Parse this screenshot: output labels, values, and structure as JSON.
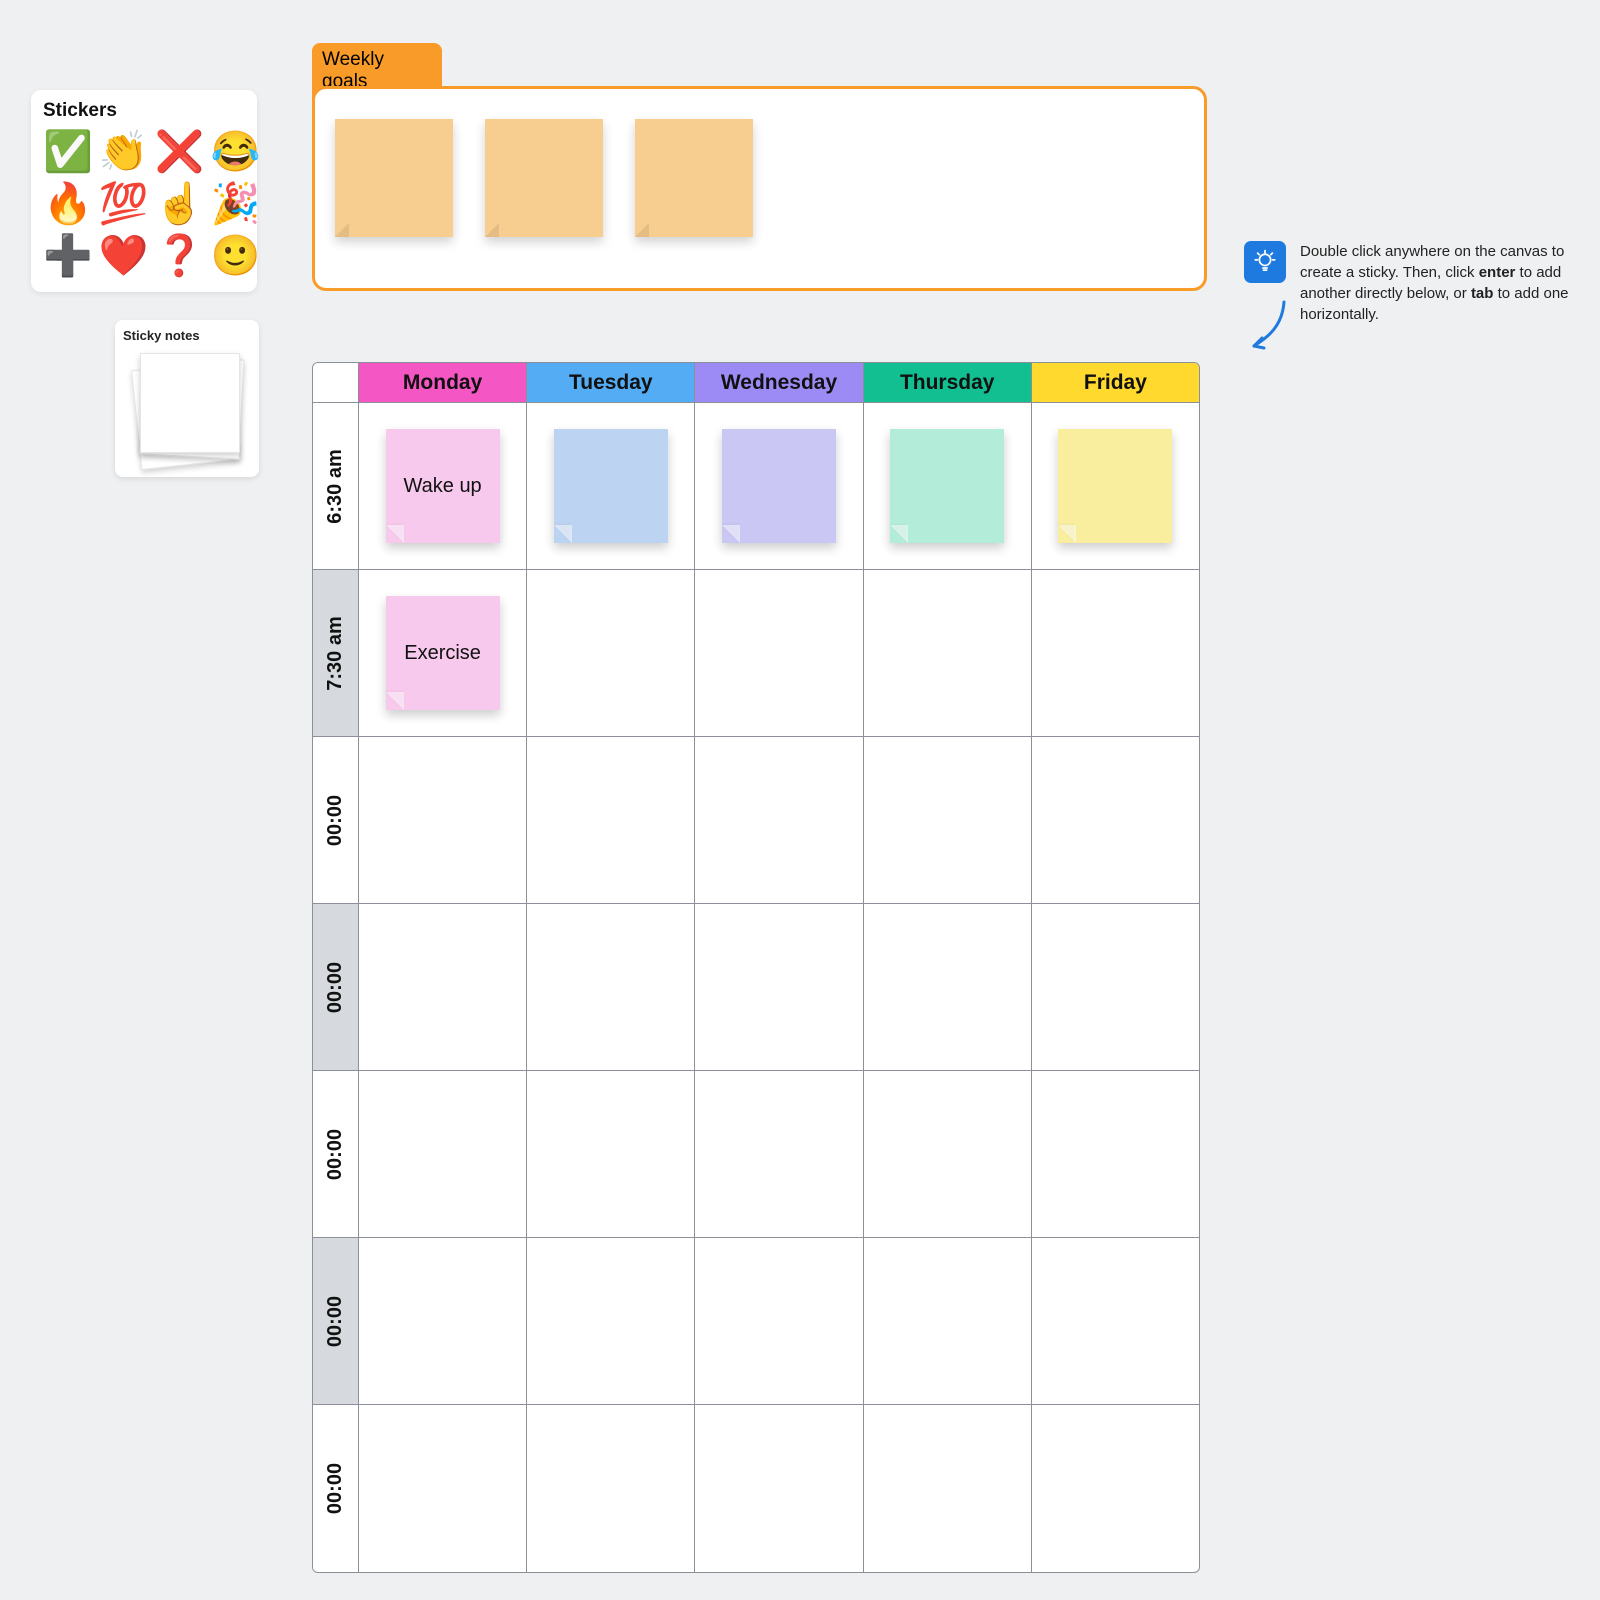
{
  "stickers": {
    "title": "Stickers",
    "items": [
      "✅",
      "👏",
      "❌",
      "😂",
      "🔥",
      "💯",
      "☝️",
      "🎉",
      "➕",
      "❤️",
      "❓",
      "🙂"
    ]
  },
  "sticky_panel": {
    "title": "Sticky notes"
  },
  "goals": {
    "tab_line1": "Weekly",
    "tab_line2": "goals",
    "notes": [
      "",
      "",
      ""
    ]
  },
  "tip": {
    "pre": "Double click anywhere on the canvas to create a sticky. Then, click ",
    "b1": "enter",
    "mid": " to add another directly below, or ",
    "b2": "tab",
    "post": " to add one horizontally."
  },
  "schedule": {
    "days": [
      {
        "label": "Monday",
        "hdr_class": "hdr-mon"
      },
      {
        "label": "Tuesday",
        "hdr_class": "hdr-tue"
      },
      {
        "label": "Wednesday",
        "hdr_class": "hdr-wed"
      },
      {
        "label": "Thursday",
        "hdr_class": "hdr-thu"
      },
      {
        "label": "Friday",
        "hdr_class": "hdr-fri"
      }
    ],
    "rows": [
      {
        "time": "6:30 am",
        "alt": false,
        "notes": [
          {
            "text": "Wake up",
            "color": "pink"
          },
          {
            "text": "",
            "color": "blue"
          },
          {
            "text": "",
            "color": "purple"
          },
          {
            "text": "",
            "color": "teal"
          },
          {
            "text": "",
            "color": "yellow"
          }
        ]
      },
      {
        "time": "7:30 am",
        "alt": true,
        "notes": [
          {
            "text": "Exercise",
            "color": "pink"
          },
          null,
          null,
          null,
          null
        ]
      },
      {
        "time": "00:00",
        "alt": false,
        "notes": [
          null,
          null,
          null,
          null,
          null
        ]
      },
      {
        "time": "00:00",
        "alt": true,
        "notes": [
          null,
          null,
          null,
          null,
          null
        ]
      },
      {
        "time": "00:00",
        "alt": false,
        "notes": [
          null,
          null,
          null,
          null,
          null
        ]
      },
      {
        "time": "00:00",
        "alt": true,
        "notes": [
          null,
          null,
          null,
          null,
          null
        ]
      },
      {
        "time": "00:00",
        "alt": false,
        "notes": [
          null,
          null,
          null,
          null,
          null
        ]
      }
    ]
  }
}
